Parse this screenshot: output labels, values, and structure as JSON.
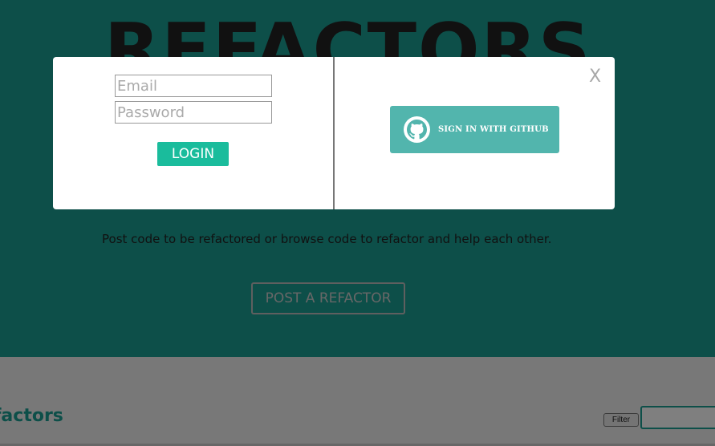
{
  "hero": {
    "title": "REFACTORS",
    "tagline": "Post code to be refactored or browse code to refactor and help each other.",
    "post_button": "POST A REFACTOR"
  },
  "lower": {
    "section_title": "Refactors",
    "filter_button": "Filter",
    "filter_value": ""
  },
  "modal": {
    "email_placeholder": "Email",
    "password_placeholder": "Password",
    "login_button": "LOGIN",
    "github_button": "SIGN IN WITH GITHUB",
    "close_label": "X",
    "github_icon": "github-icon"
  },
  "colors": {
    "hero_bg": "#1a9e93",
    "login_btn": "#1abc9c",
    "github_btn": "#52b5ad"
  }
}
